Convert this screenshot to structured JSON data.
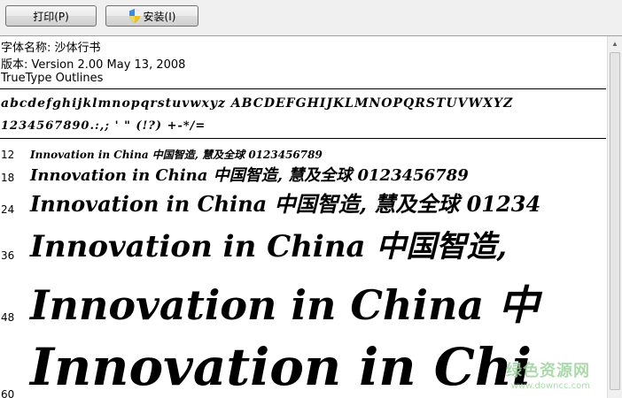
{
  "toolbar": {
    "print_label": "打印(P)",
    "install_label": "安装(I)"
  },
  "font_info": {
    "name_line": "字体名称: 沙体行书",
    "version_line": "版本: Version 2.00 May 13, 2008",
    "type_line": "TrueType Outlines"
  },
  "charset": {
    "letters": "abcdefghijklmnopqrstuvwxyz ABCDEFGHIJKLMNOPQRSTUVWXYZ",
    "digits": "1234567890.:,; ' \" (!?) +-*/="
  },
  "samples": [
    {
      "size": "12",
      "text": "Innovation in China 中国智造, 慧及全球 0123456789"
    },
    {
      "size": "18",
      "text": "Innovation in China 中国智造, 慧及全球 0123456789"
    },
    {
      "size": "24",
      "text": "Innovation in China 中国智造, 慧及全球 01234"
    },
    {
      "size": "36",
      "text": "Innovation in China 中国智造,"
    },
    {
      "size": "48",
      "text": "Innovation in China 中"
    },
    {
      "size": "60",
      "text": "Innovation in Chi"
    }
  ],
  "watermark": {
    "main": "绿色资源网",
    "sub": "www.downcc.com"
  }
}
